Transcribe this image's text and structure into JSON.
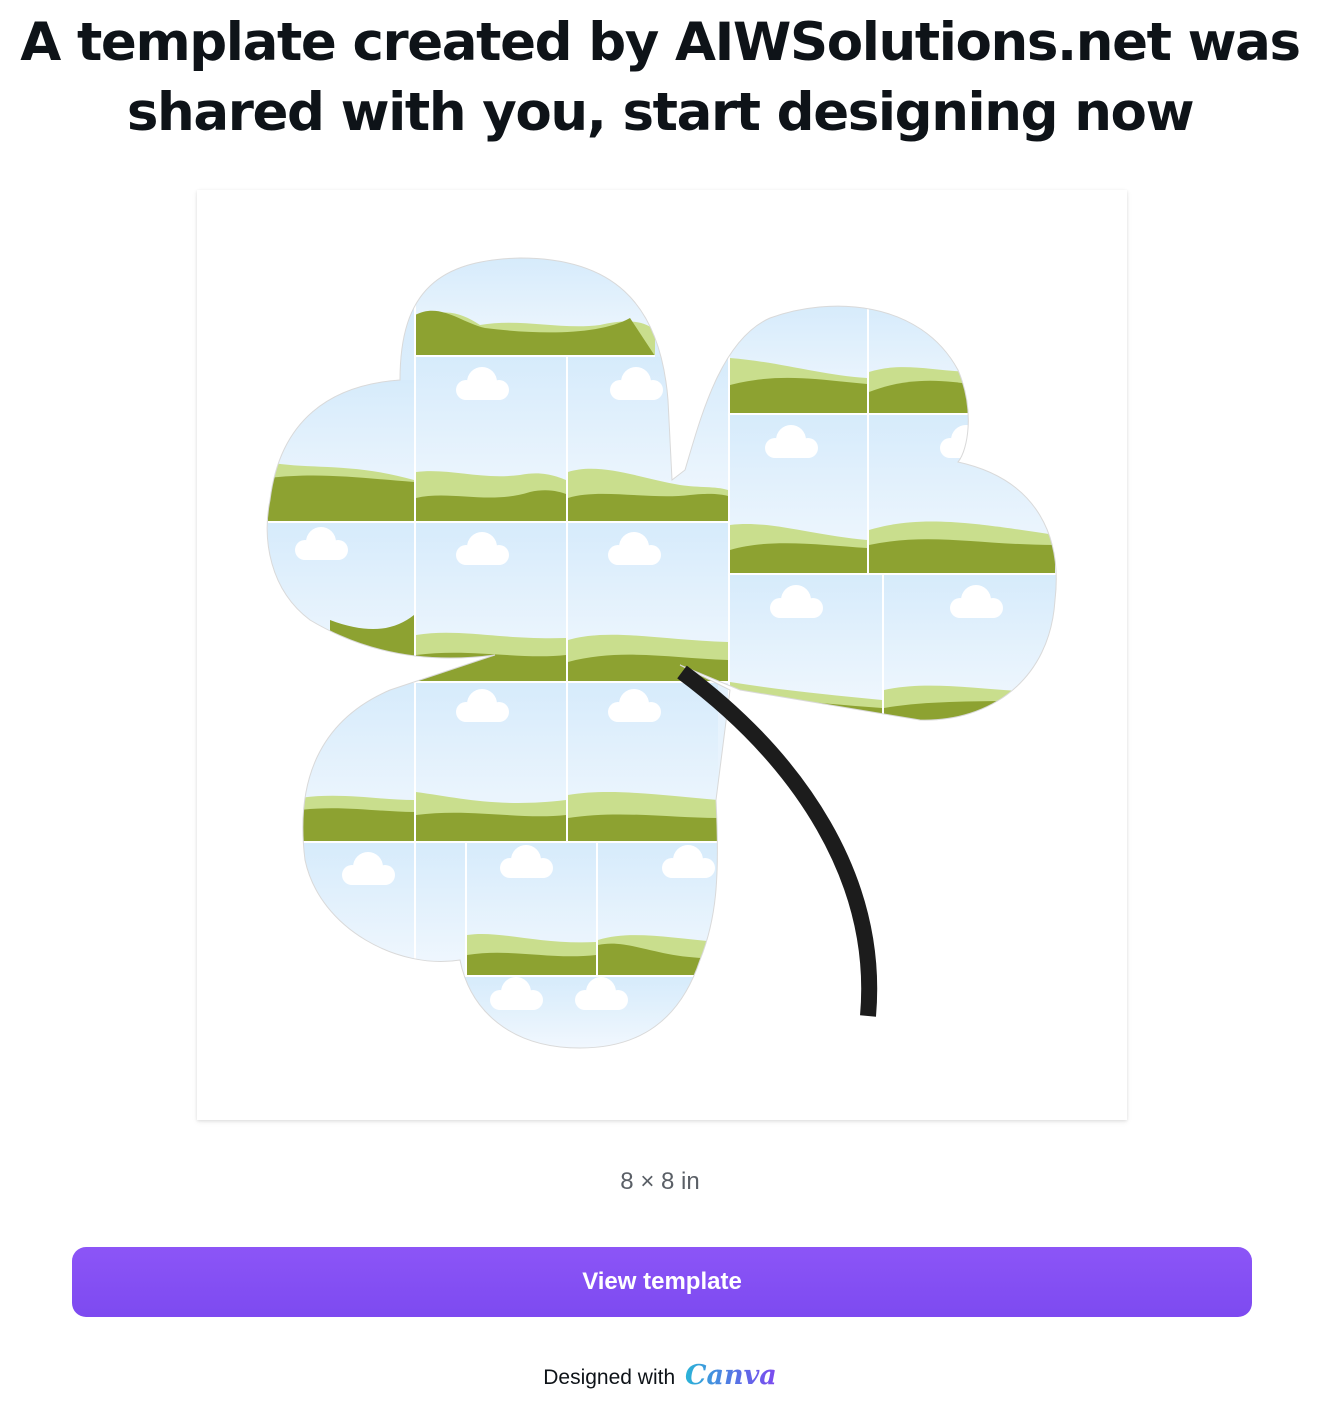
{
  "header": {
    "line1": "A template created by AIWSolutions.net was",
    "line2": "shared with you, start designing now"
  },
  "preview": {
    "dimensions": "8 × 8 in",
    "artwork": "clover-photo-collage",
    "colors": {
      "sky_top": "#d6ebfb",
      "sky_bottom": "#f2f8fe",
      "hill_light": "#c9de8d",
      "hill_dark": "#8da231",
      "cloud": "#ffffff",
      "stem": "#1c1c1c"
    }
  },
  "actions": {
    "view_label": "View template",
    "button_color": "#8453f5"
  },
  "footer": {
    "prefix": "Designed with",
    "brand": "Canva"
  }
}
